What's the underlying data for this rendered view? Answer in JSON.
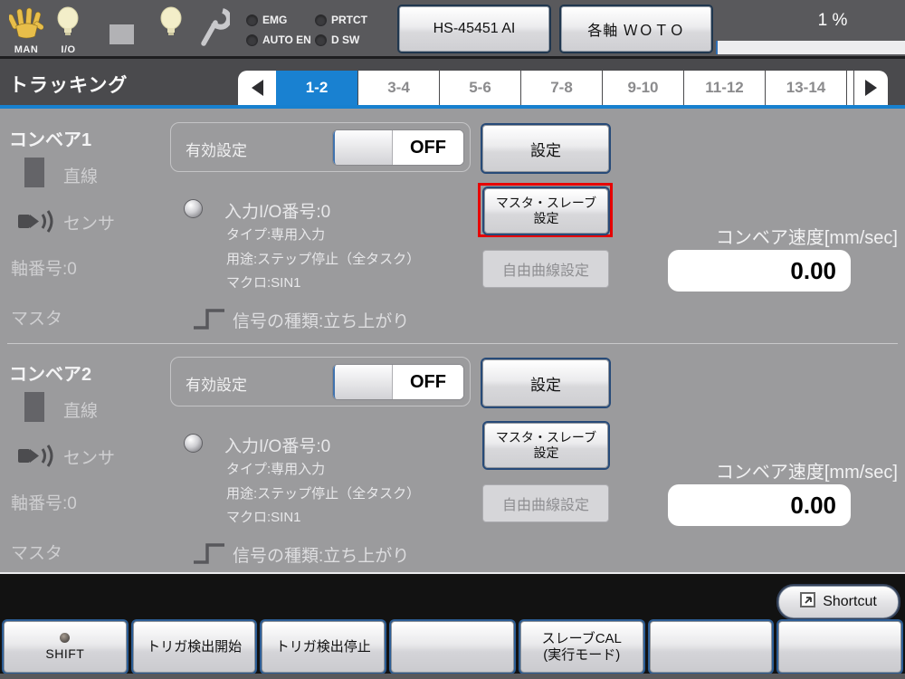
{
  "colors": {
    "accent_blue": "#1981d1",
    "highlight_red": "#e60000",
    "content_gray": "#9b9b9d"
  },
  "topbar": {
    "man_label": "MAN",
    "io_label": "I/O",
    "indicators": [
      {
        "label": "EMG"
      },
      {
        "label": "PRTCT"
      },
      {
        "label": "AUTO EN"
      },
      {
        "label": "D SW"
      }
    ],
    "robot_button_label": "HS-45451 AI",
    "mode_button_label": "各軸 ＷＯＴＯ",
    "speed_percent_text": "1 %",
    "progress_percent": 1
  },
  "tabbar": {
    "title": "トラッキング",
    "tabs": [
      {
        "label": "1-2",
        "selected": true
      },
      {
        "label": "3-4",
        "selected": false
      },
      {
        "label": "5-6",
        "selected": false
      },
      {
        "label": "7-8",
        "selected": false
      },
      {
        "label": "9-10",
        "selected": false
      },
      {
        "label": "11-12",
        "selected": false
      },
      {
        "label": "13-14",
        "selected": false
      }
    ]
  },
  "conveyors": [
    {
      "name": "コンベア1",
      "line_type": "直線",
      "sensor_label": "センサ",
      "axis_label": "軸番号:0",
      "master_label": "マスタ",
      "enable_label": "有効設定",
      "enable_state": "OFF",
      "io_number": "入力I/O番号:0",
      "io_type": "タイプ:専用入力",
      "io_usage": "用途:ステップ停止（全タスク）",
      "io_macro": "マクロ:SIN1",
      "signal_kind": "信号の種類:立ち上がり",
      "btn_settings": "設定",
      "btn_master_slave_line1": "マスタ・スレーブ",
      "btn_master_slave_line2": "設定",
      "btn_free_curve": "自由曲線設定",
      "speed_label": "コンベア速度[mm/sec]",
      "speed_value": "0.00",
      "master_slave_highlighted": true
    },
    {
      "name": "コンベア2",
      "line_type": "直線",
      "sensor_label": "センサ",
      "axis_label": "軸番号:0",
      "master_label": "マスタ",
      "enable_label": "有効設定",
      "enable_state": "OFF",
      "io_number": "入力I/O番号:0",
      "io_type": "タイプ:専用入力",
      "io_usage": "用途:ステップ停止（全タスク）",
      "io_macro": "マクロ:SIN1",
      "signal_kind": "信号の種類:立ち上がり",
      "btn_settings": "設定",
      "btn_master_slave_line1": "マスタ・スレーブ",
      "btn_master_slave_line2": "設定",
      "btn_free_curve": "自由曲線設定",
      "speed_label": "コンベア速度[mm/sec]",
      "speed_value": "0.00",
      "master_slave_highlighted": false
    }
  ],
  "shortcut": {
    "label": "Shortcut"
  },
  "function_keys": [
    {
      "label": "SHIFT",
      "has_led": true
    },
    {
      "label": "トリガ検出開始"
    },
    {
      "label": "トリガ検出停止"
    },
    {
      "label": ""
    },
    {
      "label": "スレーブCAL",
      "label2": "(実行モード)"
    },
    {
      "label": ""
    },
    {
      "label": ""
    }
  ]
}
